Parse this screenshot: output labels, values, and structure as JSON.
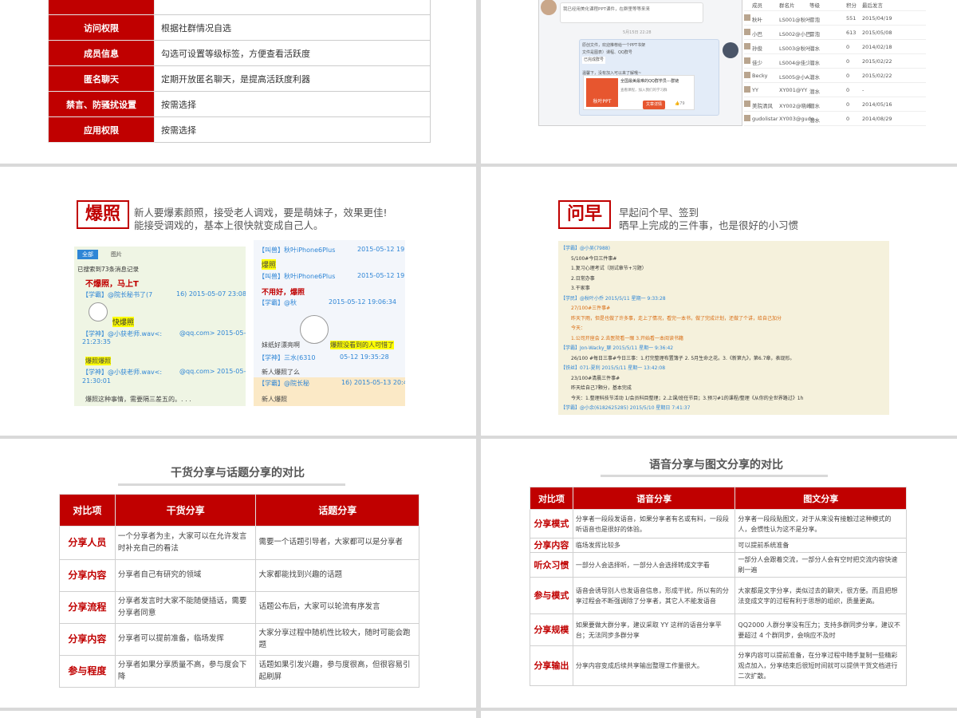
{
  "slide1": {
    "rows": [
      {
        "key": "访问权限",
        "val": "根据社群情况自选"
      },
      {
        "key": "成员信息",
        "val": "勾选可设置等级标签，方便查看活跃度"
      },
      {
        "key": "匿名聊天",
        "val": "定期开放匿名聊天，是提高活跃度利器"
      },
      {
        "key": "禁言、防骚扰设置",
        "val": "按需选择"
      },
      {
        "key": "应用权限",
        "val": "按需选择"
      }
    ]
  },
  "slide2": {
    "chat": {
      "msg1": "我已经用美化课程PPT课件，在群里等等来来",
      "time": "5月15日 22:28",
      "msg2a": "原创文件，欢迎推荐给一个PPT书架",
      "msg2b": "文件是图表）课程、QQ群号",
      "msg2c": "已完成群号",
      "msg3": "温馨下，没有加入可以来了解哦~",
      "card_title": "全国最美最难的QQ群学员---群链",
      "card_sub": "查看课程，加入我们的学习群",
      "card_btn": "文章详情",
      "card_likes": "79",
      "card_brand": "秋叶PPT"
    },
    "members": {
      "header": [
        "成员",
        "群名片",
        "等级",
        "积分",
        "最后发言"
      ],
      "rows": [
        {
          "name": "秋叶",
          "card": "LS001@秋叶",
          "level": "冒泡",
          "points": "551",
          "date": "2015/04/19"
        },
        {
          "name": "小巴",
          "card": "LS002@小巴..",
          "level": "冒泡",
          "points": "613",
          "date": "2015/05/08"
        },
        {
          "name": "孙俊",
          "card": "LS003@秋叶..",
          "level": "潜水",
          "points": "0",
          "date": "2014/02/18"
        },
        {
          "name": "佳少",
          "card": "LS004@佳少..",
          "level": "潜水",
          "points": "0",
          "date": "2015/02/22"
        },
        {
          "name": "Becky",
          "card": "LS005@小A..",
          "level": "潜水",
          "points": "0",
          "date": "2015/02/22"
        },
        {
          "name": "YY",
          "card": "XY001@YY",
          "level": "潜水",
          "points": "0",
          "date": "-"
        },
        {
          "name": "美院清风",
          "card": "XY002@晓峰",
          "level": "潜水",
          "points": "0",
          "date": "2014/05/16"
        },
        {
          "name": "gudolistar",
          "card": "XY003@gudo..",
          "level": "潜水",
          "points": "0",
          "date": "2014/08/29"
        }
      ]
    }
  },
  "slide3": {
    "tag": "爆照",
    "desc1": "新人要爆素颜照，接受老人调戏，要是萌妹子，效果更佳!",
    "desc2": "能接受调戏的，基本上很快就变成自己人。",
    "left": {
      "tab_all": "全部",
      "tab_img": "图片",
      "found": "已搜索到73条消息记录",
      "l1": "不爆照，马上T",
      "l2": "【学霸】@院长秘书了(7",
      "l2t": "16) 2015-05-07 23:08",
      "l3": "快爆照",
      "l4": "【学神】@小获老师.wav<:",
      "l4t": "@qq.com> 2015-05-",
      "l4d": "21:23:35",
      "l5": "爆照爆照",
      "l6": "【学神】@小获老师.wav<:",
      "l6t": "@qq.com> 2015-05-",
      "l6d": "21:30:01",
      "l7": "爆照这种事情，需要隔三差五的。. . ."
    },
    "right": {
      "r1": "【叫兽】秋叶iPhone6Plus",
      "r1t": "2015-05-12 19:01",
      "r2": "爆照",
      "r3": "【叫兽】秋叶iPhone6Plus",
      "r3t": "2015-05-12 19:02",
      "r4": "不用好，爆照",
      "r5": "【学霸】@秋",
      "r5t": "2015-05-12 19:06:34",
      "r6": "妹纸好漂亮啊",
      "r6b": "爆照没看到的人可惜了",
      "r7": "【学神】三水(6310",
      "r7t": "05-12 19:35:28",
      "r8": "新人爆照了么",
      "r9": "【学霸】@院长秘",
      "r9t": "16) 2015-05-13 20:49",
      "r10": "新人爆照"
    }
  },
  "slide4": {
    "tag": "问早",
    "desc1": "早起问个早、签到",
    "desc2": "晒早上完成的三件事，也是很好的小习惯",
    "lines": [
      "【学霸】@小吴(7988)",
      "5/100#今日三件事#",
      "1.复习心理考试（测试章节+习题）",
      "2.日常办事",
      "3.干家事",
      "【学民】@秋叶小乔 2015/5/11 星期一 9:33:28",
      "27/100#三件事#",
      "昨天下雨，但是也做了许多事，走上了情况，看完一本书，做了完成计划，还做了个讲，给自己加分",
      "今天：",
      "1.公司开座会 2.去医院看一眼 3.开始看一本阅读书籍",
      "【学霸】Jon-Wacky_聊 2015/5/11 星期一 9:36:42",
      "26/100 #每日三事#今日三事：1.打完整理布置簿子 2. 5月生命之花。3.《新第九》，第6.7章，表现形。",
      "【铁丝】071-夏利 2015/5/11 星期一 13:42:08",
      "23/100#清晨三件事#",
      "昨天给自己7颗分，基本完成",
      "今天：1.整理科技节活动 1/会员科目整理；2.上课/班任节目；3.预习#1的课程/整理《从你的全世界路过》1h",
      "【学霸】@小余(6182625285) 2015/5/10 星期日 7:41:37"
    ]
  },
  "slide5": {
    "title": "干货分享与话题分享的对比",
    "headers": [
      "对比项",
      "干货分享",
      "话题分享"
    ],
    "rows": [
      {
        "k": "分享人员",
        "a": "一个分享者为主，大家可以在允许发言时补充自己的看法",
        "b": "需要一个话题引导者，大家都可以是分享者"
      },
      {
        "k": "分享内容",
        "a": "分享者自己有研究的领域",
        "b": "大家都能找到兴趣的话题"
      },
      {
        "k": "分享流程",
        "a": "分享者发言时大家不能随便插话，需要分享者同意",
        "b": "话题公布后，大家可以轮流有序发言"
      },
      {
        "k": "分享内容",
        "a": "分享者可以提前准备，临场发挥",
        "b": "大家分享过程中随机性比较大，随时可能会跑题"
      },
      {
        "k": "参与程度",
        "a": "分享者如果分享质量不高，参与度会下降",
        "b": "话题如果引发兴趣，参与度很高，但很容易引起刷屏"
      }
    ]
  },
  "slide6": {
    "title": "语音分享与图文分享的对比",
    "headers": [
      "对比项",
      "语音分享",
      "图文分享"
    ],
    "rows": [
      {
        "k": "分享模式",
        "a": "分享者一段段发语音，如果分享者有名或有料，一段段听语音也是很好的体验。",
        "b": "分享者一段段贴图文，对于从来没有接触过这种模式的人，会惯性认为这不是分享。"
      },
      {
        "k": "分享内容",
        "a": "临场发挥比较多",
        "b": "可以提前系统准备"
      },
      {
        "k": "听众习惯",
        "a": "一部分人会选择听，一部分人会选择转成文字看",
        "b": "一部分人会跟着交流，一部分人会有空时把交流内容快速刷一遍"
      },
      {
        "k": "参与模式",
        "a": "语音会诱导别人也发语音信息，形成干扰，所以有的分享过程会不断强调除了分享者，其它人不能发语音",
        "b": "大家都是文字分享，类似过去的聊天，很方便。而且把想法变成文字的过程有利于思想的组织，质量更高。"
      },
      {
        "k": "分享规模",
        "a": "如果要做大群分享，建议采取 YY 这样的语音分享平台；无法同步多群分享",
        "b": "QQ2000 人群分享没有压力；支持多群同步分享，建议不要超过 4 个群同步，会响应不及时"
      },
      {
        "k": "分享输出",
        "a": "分享内容变成后续共享输出整理工作量很大。",
        "b": "分享内容可以提前准备，在分享过程中随手复制一些精彩观点加入，分享结束后很短时间就可以提供干货文档进行二次扩散。"
      }
    ]
  },
  "colors": {
    "accent": "#c00000",
    "highlight": "#ffff00",
    "background": "#d9d9d9"
  }
}
